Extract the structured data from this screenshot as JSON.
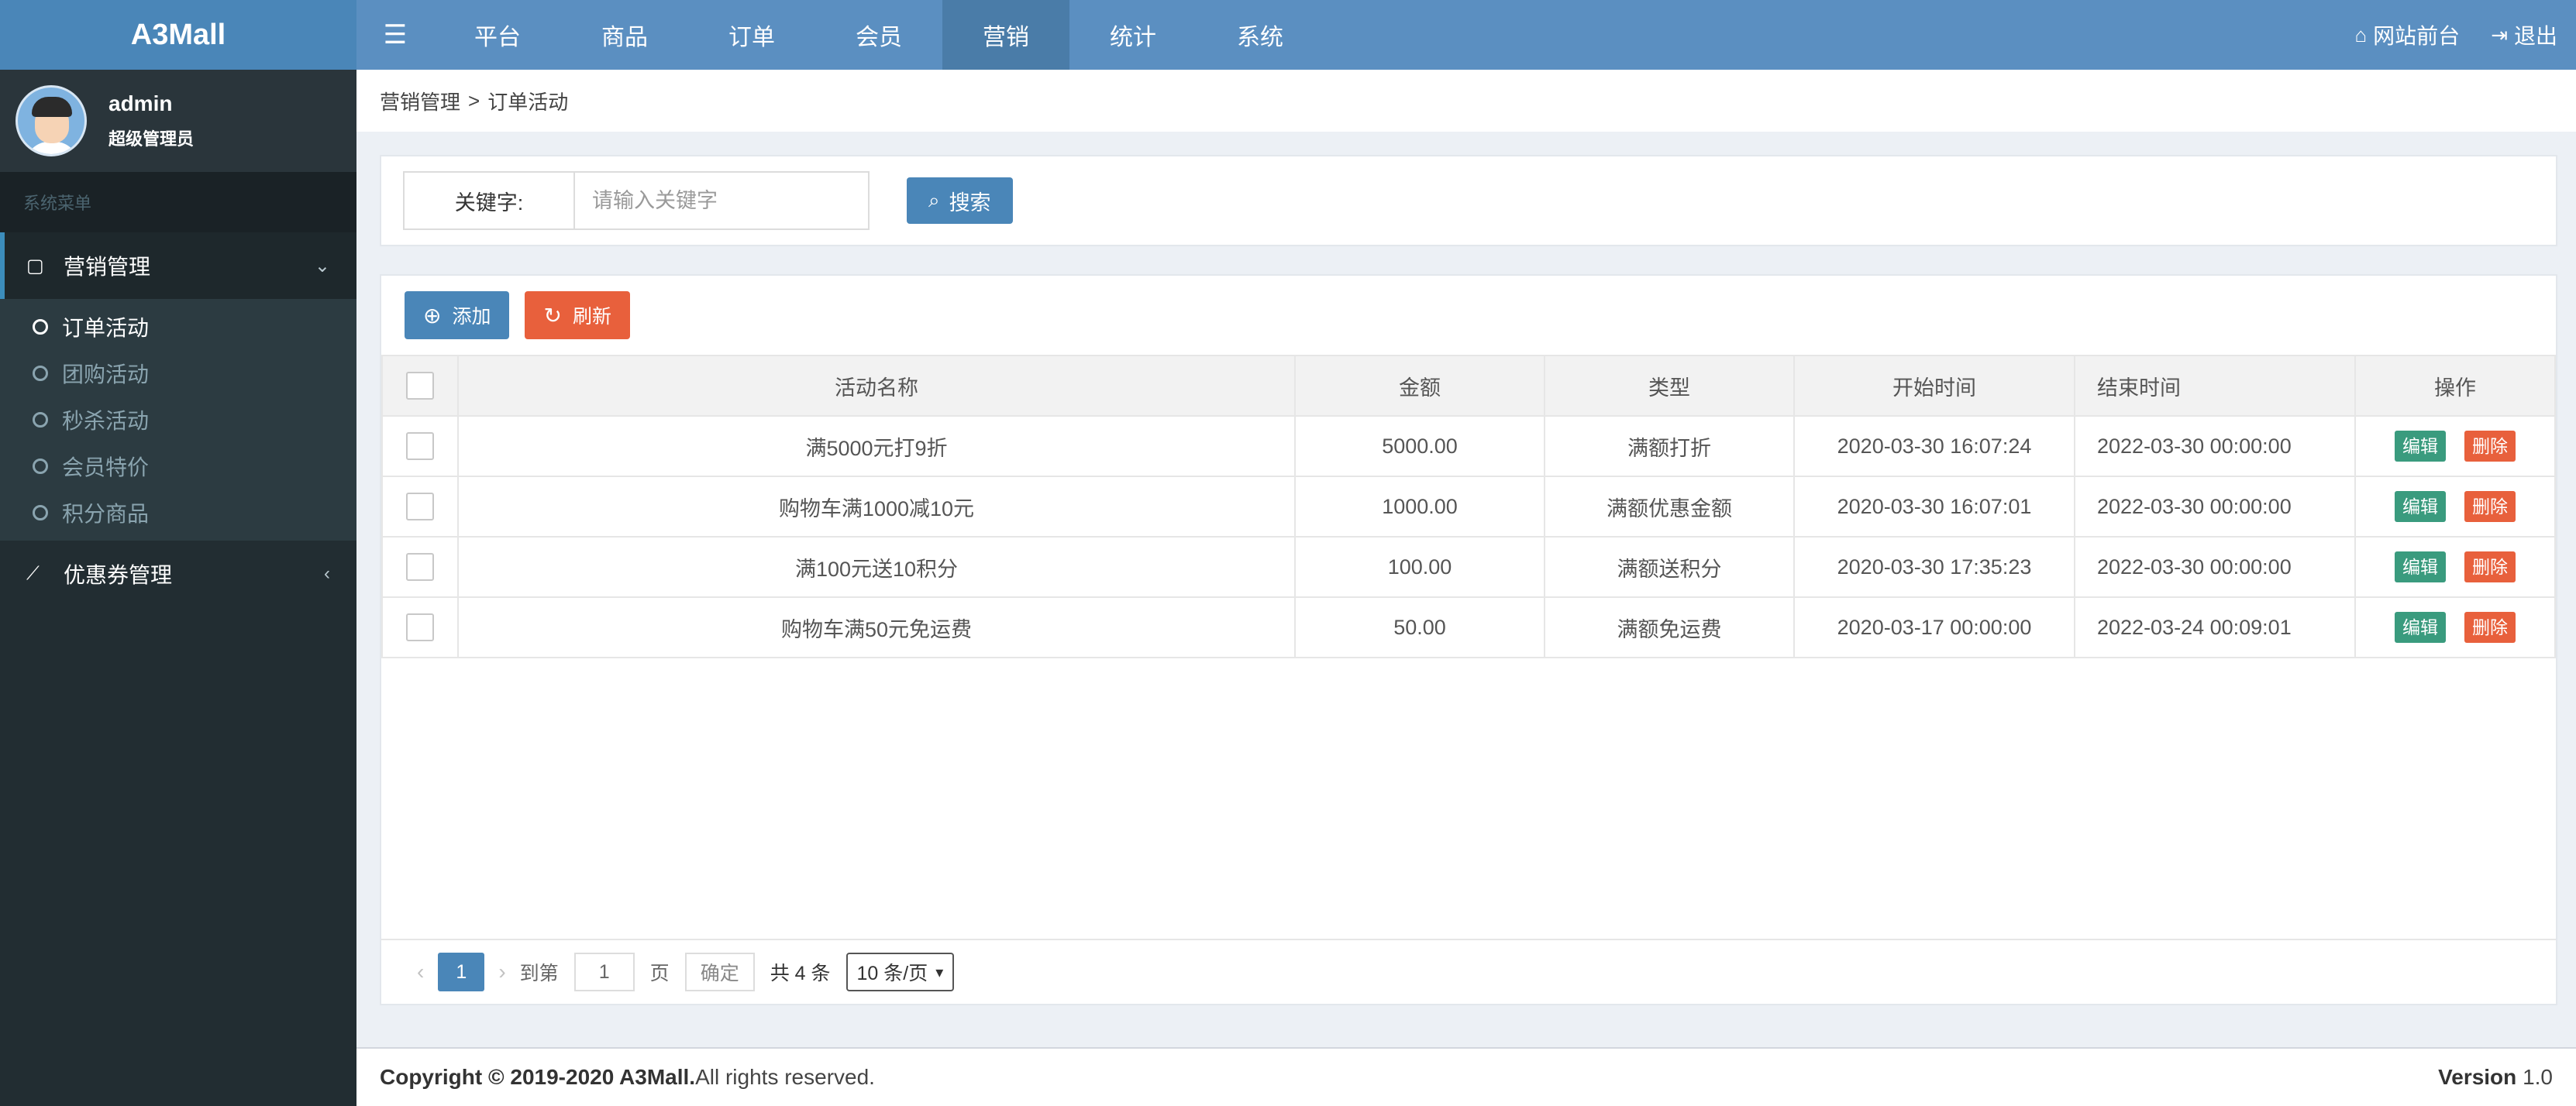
{
  "app": {
    "logo": "A3Mall"
  },
  "topnav": {
    "toggle_icon": "menu-icon",
    "items": [
      "平台",
      "商品",
      "订单",
      "会员",
      "营销",
      "统计",
      "系统"
    ],
    "active_index": 4,
    "right": [
      {
        "icon": "home-icon",
        "glyph": "⌂",
        "label": "网站前台"
      },
      {
        "icon": "logout-icon",
        "glyph": "⇥",
        "label": "退出"
      }
    ]
  },
  "user": {
    "name": "admin",
    "role": "超级管理员"
  },
  "sidebar": {
    "header": "系统菜单",
    "groups": [
      {
        "label": "营销管理",
        "icon": "note-icon",
        "open": true,
        "items": [
          {
            "label": "订单活动",
            "active": true
          },
          {
            "label": "团购活动"
          },
          {
            "label": "秒杀活动"
          },
          {
            "label": "会员特价"
          },
          {
            "label": "积分商品"
          }
        ]
      },
      {
        "label": "优惠券管理",
        "icon": "line-chart-icon",
        "open": false
      }
    ]
  },
  "breadcrumb": {
    "parent": "营销管理",
    "sep": ">",
    "current": "订单活动"
  },
  "search": {
    "label": "关键字:",
    "placeholder": "请输入关键字",
    "value": "",
    "button": "搜索"
  },
  "toolbar": {
    "add": "添加",
    "refresh": "刷新"
  },
  "table": {
    "headers": [
      "活动名称",
      "金额",
      "类型",
      "开始时间",
      "结束时间",
      "操作"
    ],
    "rows": [
      [
        "满5000元打9折",
        "5000.00",
        "满额打折",
        "2020-03-30 16:07:24",
        "2022-03-30 00:00:00"
      ],
      [
        "购物车满1000减10元",
        "1000.00",
        "满额优惠金额",
        "2020-03-30 16:07:01",
        "2022-03-30 00:00:00"
      ],
      [
        "满100元送10积分",
        "100.00",
        "满额送积分",
        "2020-03-30 17:35:23",
        "2022-03-30 00:00:00"
      ],
      [
        "购物车满50元免运费",
        "50.00",
        "满额免运费",
        "2020-03-17 00:00:00",
        "2022-03-24 00:09:01"
      ]
    ],
    "edit_label": "编辑",
    "delete_label": "删除"
  },
  "pager": {
    "current_page": "1",
    "goto_prefix": "到第",
    "goto_value": "1",
    "goto_suffix": "页",
    "confirm": "确定",
    "total": "共 4 条",
    "page_size": "10 条/页"
  },
  "footer": {
    "copyright_bold": "Copyright © 2019-2020 A3Mall.",
    "copyright_rest": " All rights reserved.",
    "version_label": "Version",
    "version_value": "1.0"
  },
  "colors": {
    "header": "#5b8fc1",
    "sidebar": "#222d32",
    "primary": "#4a86b8",
    "danger": "#e8603c",
    "edit": "#3a9b7e"
  }
}
